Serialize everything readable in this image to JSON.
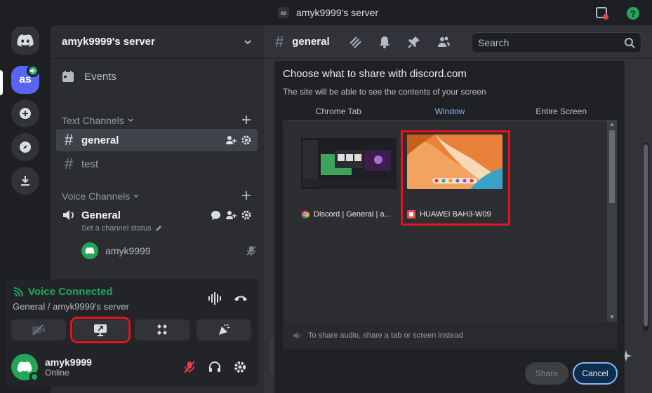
{
  "titlebar": {
    "server_chip": "as",
    "title": "amyk9999's server"
  },
  "rail": {
    "server_abbr": "as"
  },
  "sidebar": {
    "server_name": "amyk9999's server",
    "events_label": "Events",
    "text_category": "Text Channels",
    "voice_category": "Voice Channels",
    "text_channels": [
      {
        "name": "general",
        "active": true
      },
      {
        "name": "test",
        "active": false
      }
    ],
    "voice_channel": {
      "name": "General",
      "status_placeholder": "Set a channel status"
    },
    "voice_user": "amyk9999"
  },
  "voice_panel": {
    "status": "Voice Connected",
    "location": "General / amyk9999's server"
  },
  "user": {
    "name": "amyk9999",
    "status": "Online"
  },
  "main": {
    "channel": "general",
    "search_placeholder": "Search"
  },
  "dialog": {
    "title": "Choose what to share with discord.com",
    "subtitle": "The site will be able to see the contents of your screen",
    "tabs": [
      "Chrome Tab",
      "Window",
      "Entire Screen"
    ],
    "active_tab": "Window",
    "windows": [
      {
        "label": "Discord | General | a..."
      },
      {
        "label": "HUAWEI BAH3-W09"
      }
    ],
    "audio_note": "To share audio, share a tab or screen instead",
    "share_button": "Share",
    "cancel_button": "Cancel"
  },
  "colors": {
    "accent": "#5865f2",
    "green": "#23a55a",
    "highlight": "#e0161e",
    "link": "#8ab4f8"
  }
}
